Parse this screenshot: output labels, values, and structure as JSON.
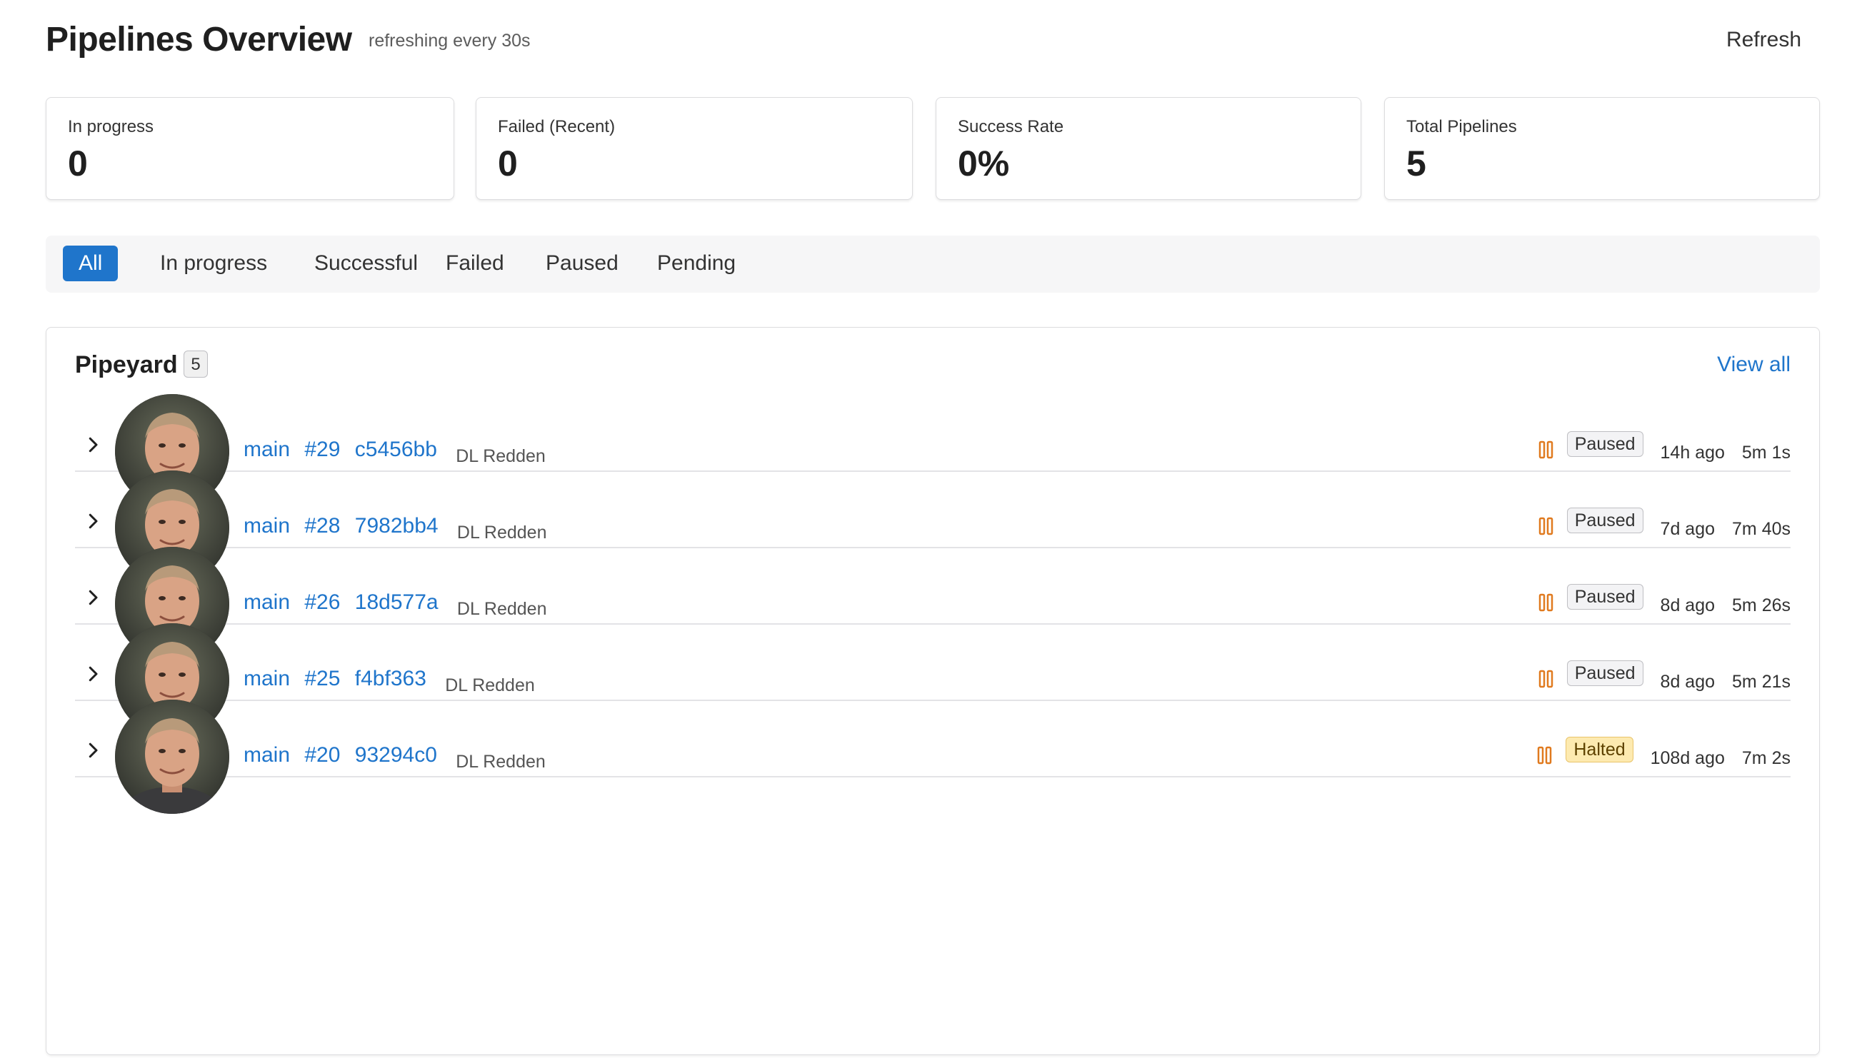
{
  "header": {
    "title": "Pipelines Overview",
    "subtitle": "refreshing every 30s",
    "refresh_label": "Refresh"
  },
  "stats": [
    {
      "label": "In progress",
      "value": "0"
    },
    {
      "label": "Failed (Recent)",
      "value": "0"
    },
    {
      "label": "Success Rate",
      "value": "0%"
    },
    {
      "label": "Total Pipelines",
      "value": "5"
    }
  ],
  "filters": [
    {
      "label": "All",
      "active": true
    },
    {
      "label": "In progress",
      "active": false
    },
    {
      "label": "Successful",
      "active": false
    },
    {
      "label": "Failed",
      "active": false
    },
    {
      "label": "Paused",
      "active": false
    },
    {
      "label": "Pending",
      "active": false
    }
  ],
  "panel": {
    "title": "Pipeyard",
    "count": "5",
    "view_all_label": "View all"
  },
  "pipelines": [
    {
      "branch": "main",
      "number": "#29",
      "sha": "c5456bb",
      "author": "DL Redden",
      "status": "Paused",
      "time_ago": "14h ago",
      "duration": "5m 1s"
    },
    {
      "branch": "main",
      "number": "#28",
      "sha": "7982bb4",
      "author": "DL Redden",
      "status": "Paused",
      "time_ago": "7d ago",
      "duration": "7m 40s"
    },
    {
      "branch": "main",
      "number": "#26",
      "sha": "18d577a",
      "author": "DL Redden",
      "status": "Paused",
      "time_ago": "8d ago",
      "duration": "5m 26s"
    },
    {
      "branch": "main",
      "number": "#25",
      "sha": "f4bf363",
      "author": "DL Redden",
      "status": "Paused",
      "time_ago": "8d ago",
      "duration": "5m 21s"
    },
    {
      "branch": "main",
      "number": "#20",
      "sha": "93294c0",
      "author": "DL Redden",
      "status": "Halted",
      "time_ago": "108d ago",
      "duration": "7m 2s"
    }
  ],
  "colors": {
    "accent": "#1f75cb",
    "paused_icon": "#e07a1f",
    "halted_badge_bg": "#fdeab0"
  },
  "icons": {
    "expand": "chevron-right-icon",
    "status": "pause-icon",
    "avatar": "user-avatar"
  }
}
